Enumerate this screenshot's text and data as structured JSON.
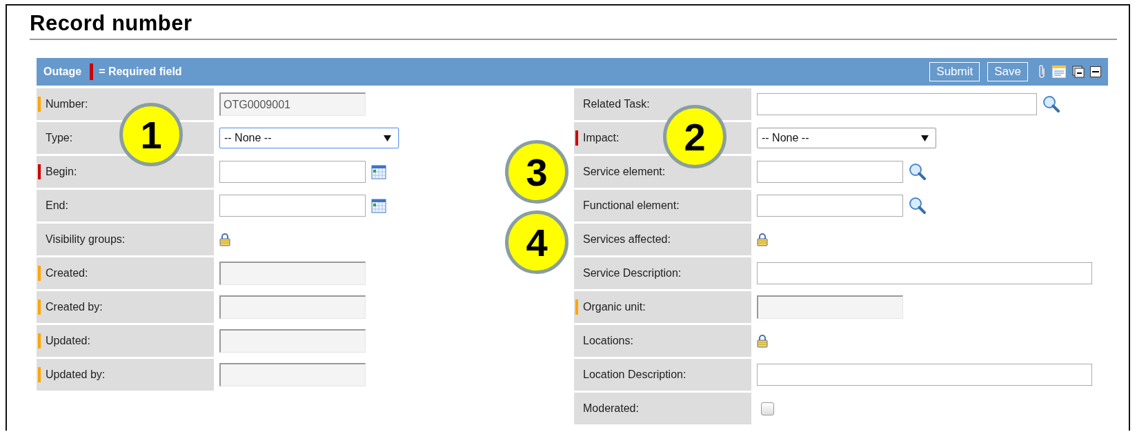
{
  "page_title": "Record number",
  "form_header": {
    "title": "Outage",
    "legend": "= Required field",
    "buttons": [
      "Submit",
      "Save"
    ]
  },
  "left_fields": [
    {
      "label": "Number:",
      "required": false,
      "locked": true,
      "kind": "readonly",
      "value": "OTG0009001"
    },
    {
      "label": "Type:",
      "required": false,
      "locked": false,
      "kind": "select",
      "value": "-- None --",
      "focused": true
    },
    {
      "label": "Begin:",
      "required": true,
      "locked": false,
      "kind": "date"
    },
    {
      "label": "End:",
      "required": false,
      "locked": false,
      "kind": "date"
    },
    {
      "label": "Visibility groups:",
      "required": false,
      "locked": false,
      "kind": "lock"
    },
    {
      "label": "Created:",
      "required": false,
      "locked": true,
      "kind": "readonly"
    },
    {
      "label": "Created by:",
      "required": false,
      "locked": true,
      "kind": "readonly"
    },
    {
      "label": "Updated:",
      "required": false,
      "locked": true,
      "kind": "readonly"
    },
    {
      "label": "Updated by:",
      "required": false,
      "locked": true,
      "kind": "readonly"
    }
  ],
  "right_fields": [
    {
      "label": "Related Task:",
      "required": false,
      "locked": false,
      "kind": "widelookup"
    },
    {
      "label": "Impact:",
      "required": true,
      "locked": false,
      "kind": "select",
      "value": "-- None --",
      "focused": false
    },
    {
      "label": "Service element:",
      "required": false,
      "locked": false,
      "kind": "lookup"
    },
    {
      "label": "Functional element:",
      "required": false,
      "locked": false,
      "kind": "lookup"
    },
    {
      "label": "Services affected:",
      "required": false,
      "locked": false,
      "kind": "lock"
    },
    {
      "label": "Service Description:",
      "required": false,
      "locked": false,
      "kind": "text"
    },
    {
      "label": "Organic unit:",
      "required": false,
      "locked": true,
      "kind": "readonly"
    },
    {
      "label": "Locations:",
      "required": false,
      "locked": false,
      "kind": "lock"
    },
    {
      "label": "Location Description:",
      "required": false,
      "locked": false,
      "kind": "text"
    },
    {
      "label": "Moderated:",
      "required": false,
      "locked": false,
      "kind": "checkbox",
      "checked": false
    }
  ],
  "callouts": [
    "1",
    "2",
    "3",
    "4"
  ]
}
